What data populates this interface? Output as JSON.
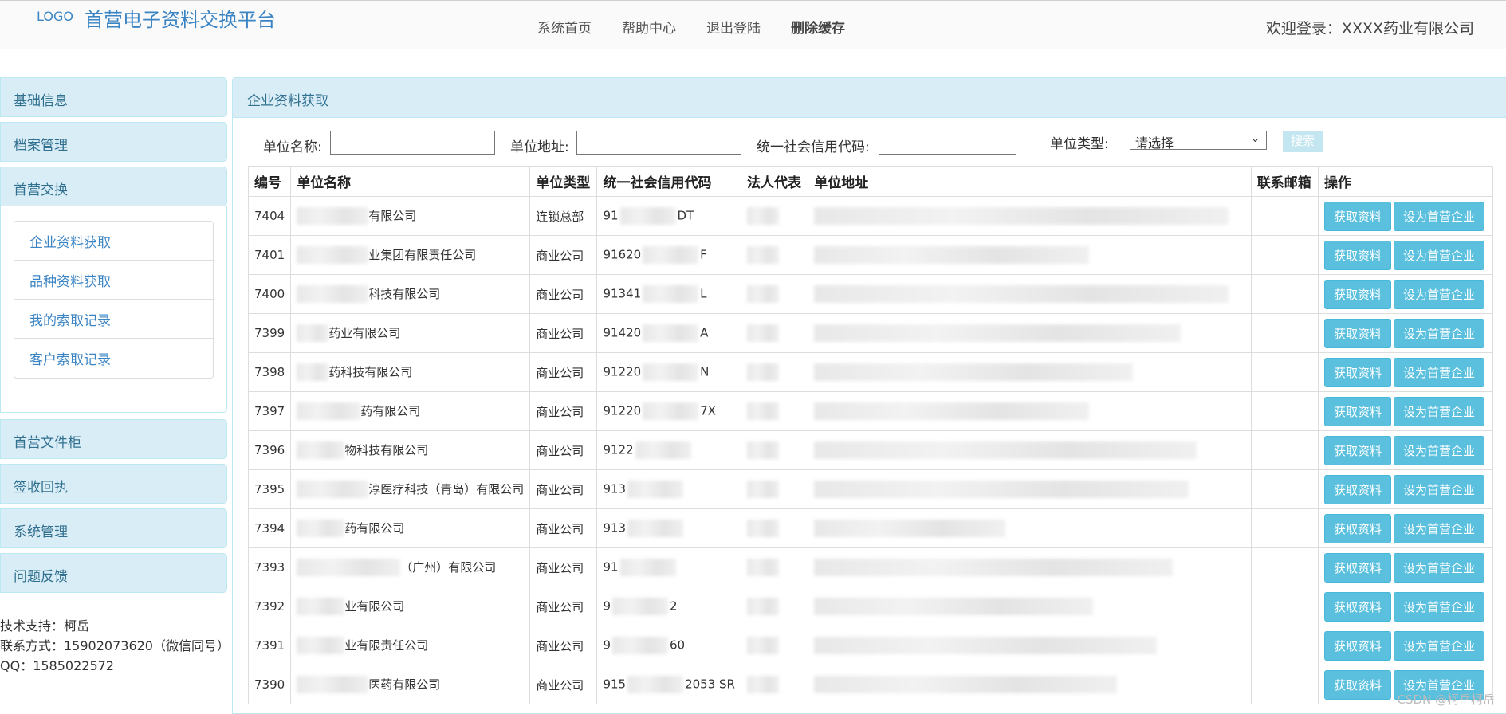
{
  "header": {
    "logo": "LOGO",
    "title": "首营电子资料交换平台",
    "nav": [
      "系统首页",
      "帮助中心",
      "退出登陆",
      "删除缓存"
    ],
    "welcome": "欢迎登录：XXXX药业有限公司"
  },
  "sidebar": {
    "items_top": [
      "基础信息",
      "档案管理",
      "首营交换"
    ],
    "submenu": [
      "企业资料获取",
      "品种资料获取",
      "我的索取记录",
      "客户索取记录"
    ],
    "items_bottom": [
      "首营文件柜",
      "签收回执",
      "系统管理",
      "问题反馈"
    ]
  },
  "support": {
    "line1": "技术支持：柯岳",
    "line2": "联系方式：15902073620（微信同号）",
    "line3": "QQ：1585022572"
  },
  "panel": {
    "title": "企业资料获取",
    "search": {
      "name_label": "单位名称:",
      "address_label": "单位地址:",
      "code_label": "统一社会信用代码:",
      "type_label": "单位类型:",
      "type_selected": "请选择",
      "button": "搜索"
    },
    "table": {
      "headers": [
        "编号",
        "单位名称",
        "单位类型",
        "统一社会信用代码",
        "法人代表",
        "单位地址",
        "联系邮箱",
        "操作"
      ],
      "btn_get": "获取资料",
      "btn_set": "设为首营企业",
      "rows": [
        {
          "id": "7404",
          "name": "有限公司",
          "type": "连锁总部",
          "code": "91",
          "code_tail": "DT"
        },
        {
          "id": "7401",
          "name": "业集团有限责任公司",
          "type": "商业公司",
          "code": "91620",
          "code_tail": "F"
        },
        {
          "id": "7400",
          "name": "科技有限公司",
          "type": "商业公司",
          "code": "91341",
          "code_tail": "L"
        },
        {
          "id": "7399",
          "name": "药业有限公司",
          "type": "商业公司",
          "code": "91420",
          "code_tail": "A"
        },
        {
          "id": "7398",
          "name": "药科技有限公司",
          "type": "商业公司",
          "code": "91220",
          "code_tail": "N"
        },
        {
          "id": "7397",
          "name": "药有限公司",
          "type": "商业公司",
          "code": "91220",
          "code_tail": "7X"
        },
        {
          "id": "7396",
          "name": "物科技有限公司",
          "type": "商业公司",
          "code": "9122",
          "code_tail": ""
        },
        {
          "id": "7395",
          "name": "淳医疗科技（青岛）有限公司",
          "type": "商业公司",
          "code": "913",
          "code_tail": ""
        },
        {
          "id": "7394",
          "name": "药有限公司",
          "type": "商业公司",
          "code": "913",
          "code_tail": ""
        },
        {
          "id": "7393",
          "name": "（广州）有限公司",
          "type": "商业公司",
          "code": "91",
          "code_tail": ""
        },
        {
          "id": "7392",
          "name": "业有限公司",
          "type": "商业公司",
          "code": "9",
          "code_tail": "2"
        },
        {
          "id": "7391",
          "name": "业有限责任公司",
          "type": "商业公司",
          "code": "9",
          "code_tail": "60"
        },
        {
          "id": "7390",
          "name": "医药有限公司",
          "type": "商业公司",
          "code": "915",
          "code_tail": "2053 SR"
        }
      ]
    }
  },
  "watermark": "CSDN @柯岳柯岳"
}
